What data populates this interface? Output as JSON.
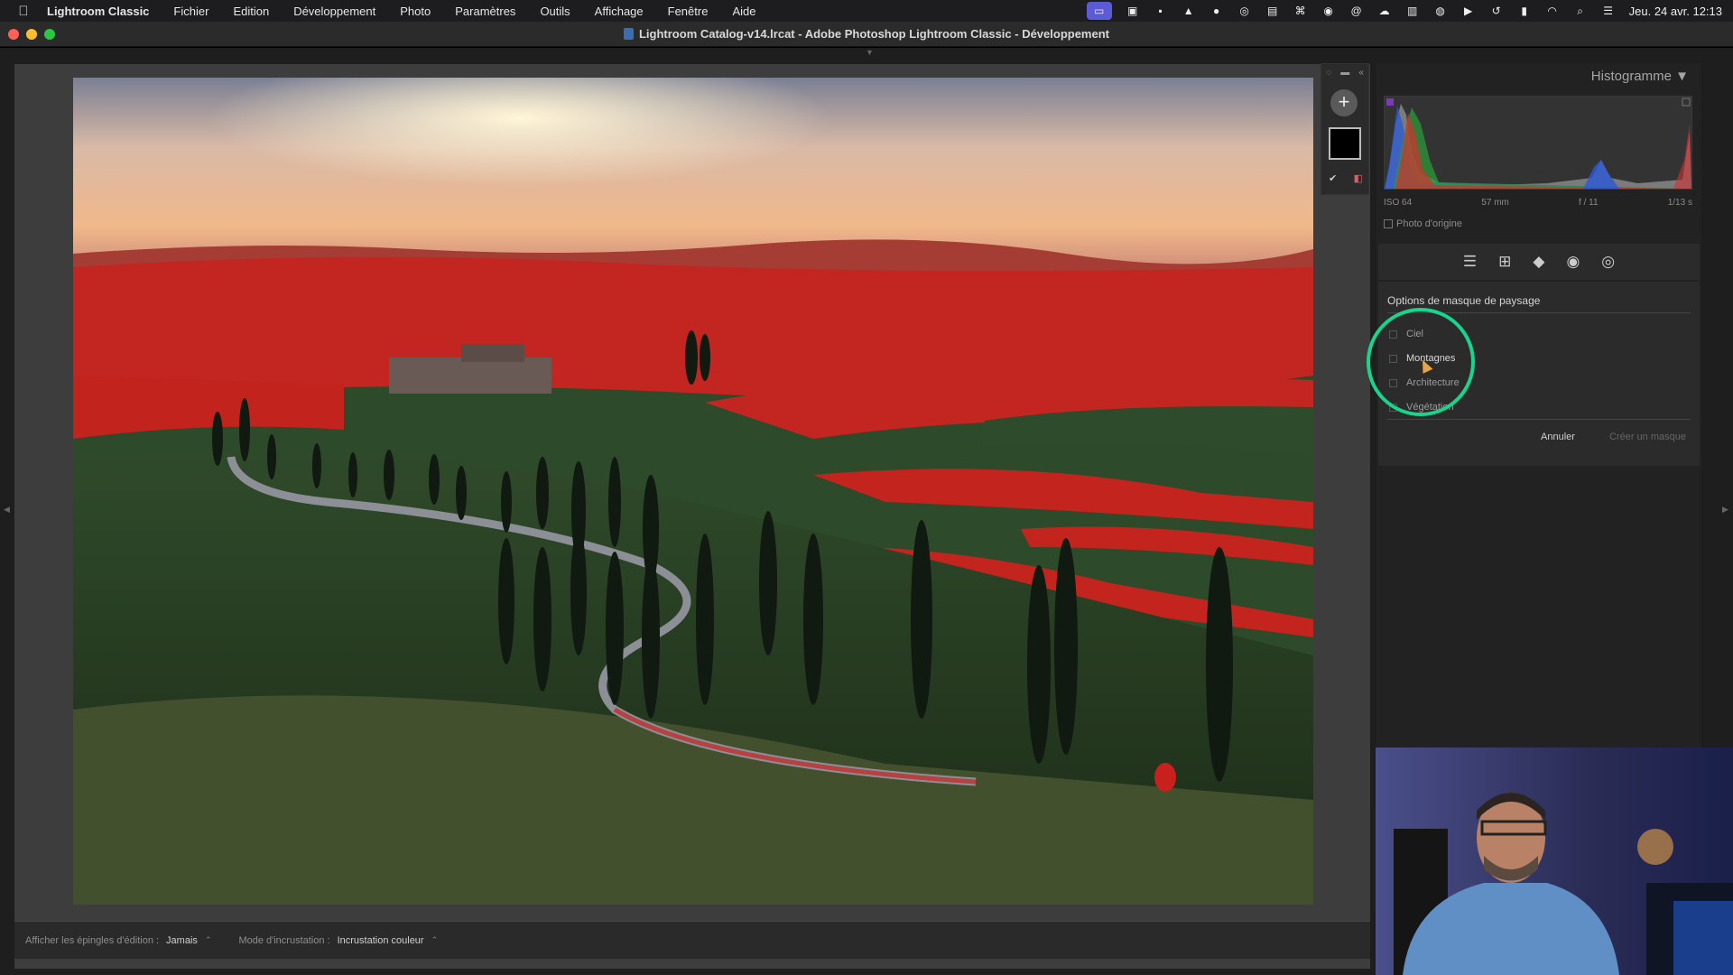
{
  "menubar": {
    "app_name": "Lightroom Classic",
    "items": [
      "Fichier",
      "Edition",
      "Développement",
      "Photo",
      "Paramètres",
      "Outils",
      "Affichage",
      "Fenêtre",
      "Aide"
    ],
    "datetime": "Jeu. 24 avr.  12:13"
  },
  "window": {
    "title": "Lightroom Catalog-v14.lrcat - Adobe Photoshop Lightroom Classic - Développement"
  },
  "bottom_toolbar": {
    "pins_label": "Afficher les épingles d'édition :",
    "pins_value": "Jamais",
    "overlay_label": "Mode d'incrustation :",
    "overlay_value": "Incrustation couleur"
  },
  "right_panel": {
    "histogram_header": "Histogramme",
    "iso": "ISO 64",
    "focal": "57 mm",
    "aperture": "f / 11",
    "shutter": "1/13 s",
    "original_photo": "Photo d'origine",
    "mask_options_title": "Options de masque de paysage",
    "options": [
      {
        "label": "Ciel",
        "checked": false
      },
      {
        "label": "Montagnes",
        "checked": false
      },
      {
        "label": "Architecture",
        "checked": false
      },
      {
        "label": "Végétation",
        "checked": false
      }
    ],
    "cancel_label": "Annuler",
    "create_label": "Créer un masque"
  },
  "colors": {
    "mask_overlay": "#c8201c",
    "highlight_ring": "#19d48c",
    "panel_bg": "#2b2b2b"
  },
  "icons": [
    "apple-icon",
    "plus-icon",
    "checkmark-icon",
    "sliders-icon",
    "crop-icon",
    "eraser-icon",
    "red-eye-icon",
    "mask-icon",
    "wifi-icon",
    "search-icon",
    "battery-icon"
  ]
}
